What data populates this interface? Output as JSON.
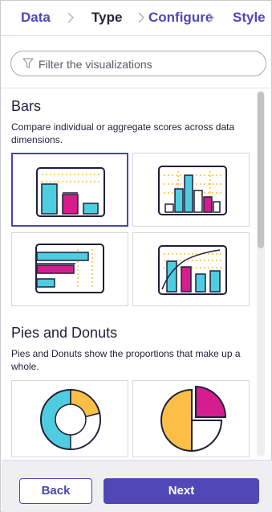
{
  "tabs": [
    {
      "label": "Data",
      "state": "link"
    },
    {
      "label": "Type",
      "state": "current"
    },
    {
      "label": "Configure",
      "state": "link"
    },
    {
      "label": "Style",
      "state": "link"
    }
  ],
  "search": {
    "placeholder": "Filter the visualizations",
    "value": ""
  },
  "sections": [
    {
      "title": "Bars",
      "description": "Compare individual or aggregate scores across data dimensions.",
      "items": [
        "bar-chart",
        "histogram",
        "horizontal-bar-chart",
        "bar-line-chart"
      ],
      "selected": "bar-chart"
    },
    {
      "title": "Pies and Donuts",
      "description": "Pies and Donuts show the proportions that make up a whole.",
      "items": [
        "donut-chart",
        "pie-chart"
      ]
    }
  ],
  "colors": {
    "accent": "#4f48b6",
    "cyan": "#4fcde0",
    "magenta": "#d61d8e",
    "orange": "#fbbf47",
    "outline": "#1f1f3a"
  },
  "footer": {
    "back_label": "Back",
    "next_label": "Next"
  }
}
